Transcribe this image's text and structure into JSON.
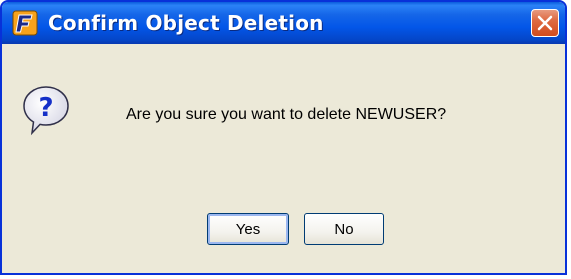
{
  "window": {
    "title": "Confirm Object Deletion",
    "app_icon": "app-logo-icon",
    "close_icon": "close-icon"
  },
  "dialog": {
    "icon": "question-icon",
    "message": "Are you sure you want to delete NEWUSER?",
    "buttons": {
      "yes_label": "Yes",
      "no_label": "No"
    }
  },
  "colors": {
    "titlebar": "#0356e8",
    "body": "#ece9d8",
    "close_button": "#d24c1e",
    "default_button_focus": "#9bb7f0"
  }
}
